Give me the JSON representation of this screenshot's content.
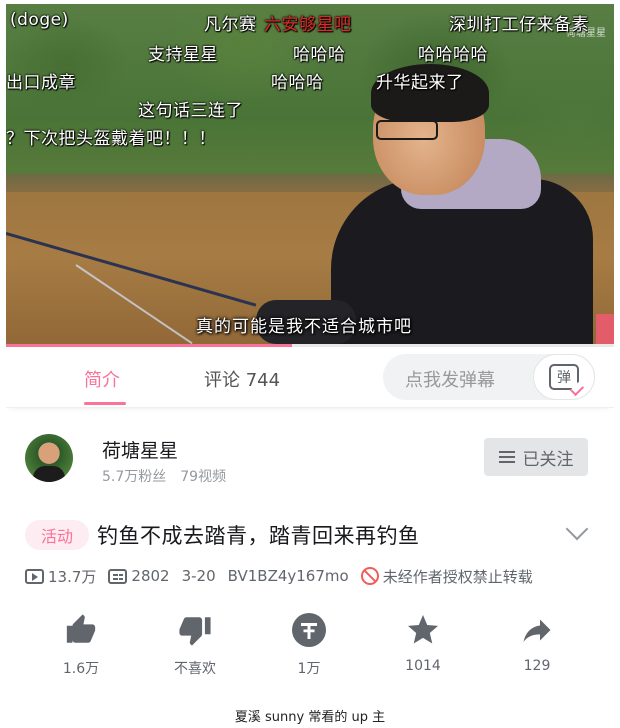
{
  "danmaku": [
    {
      "text": "(doge)",
      "color": "#ffffff"
    },
    {
      "text": "凡尔赛",
      "color": "#ffffff"
    },
    {
      "text": "六安够星吧",
      "color": "#e02828"
    },
    {
      "text": "深圳打工仔来备素",
      "color": "#ffffff"
    },
    {
      "text": "支持星星",
      "color": "#ffffff"
    },
    {
      "text": "哈哈哈",
      "color": "#ffffff"
    },
    {
      "text": "哈哈哈哈",
      "color": "#ffffff"
    },
    {
      "text": "出口成章",
      "color": "#ffffff"
    },
    {
      "text": "哈哈哈",
      "color": "#ffffff"
    },
    {
      "text": "升华起来了",
      "color": "#ffffff"
    },
    {
      "text": "这句话三连了",
      "color": "#ffffff"
    },
    {
      "text": "？下次把头盔戴着吧！！！",
      "color": "#ffffff"
    }
  ],
  "video": {
    "subtitle": "真的可能是我不适合城市吧",
    "watermark": "荷塘星星",
    "progress_fraction": 0.47
  },
  "tabs": {
    "intro": "简介",
    "comments": "评论 744",
    "danmu_placeholder": "点我发弹幕",
    "danmu_button": "弹"
  },
  "uploader": {
    "name": "荷塘星星",
    "fans": "5.7万粉丝",
    "videos": "79视频",
    "follow_label": "已关注"
  },
  "title": {
    "badge": "活动",
    "text": "钓鱼不成去踏青，踏青回来再钓鱼"
  },
  "meta": {
    "views": "13.7万",
    "danmaku_count": "2802",
    "date": "3-20",
    "bvid": "BV1BZ4y167mo",
    "copyright": "未经作者授权禁止转载"
  },
  "actions": {
    "like": "1.6万",
    "dislike": "不喜欢",
    "coin": "1万",
    "favorite": "1014",
    "share": "129"
  },
  "colors": {
    "accent": "#fb7299",
    "icon": "#61666d",
    "warning": "#f25d59"
  },
  "caption": "夏溪 sunny 常看的 up 主"
}
